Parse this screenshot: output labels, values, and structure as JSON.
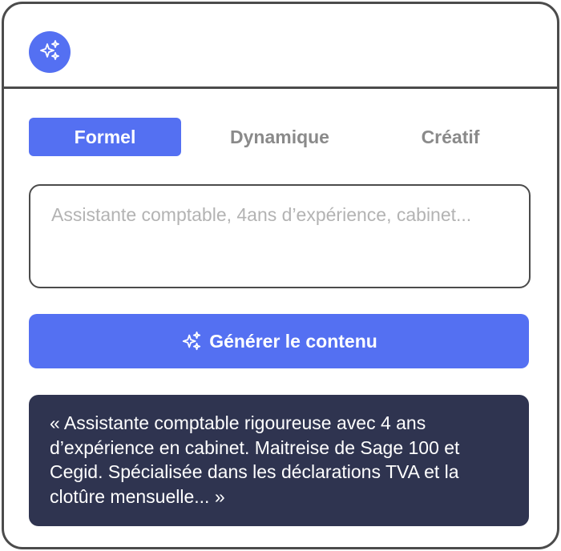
{
  "header": {
    "logo_icon": "sparkles-icon"
  },
  "tabs": [
    {
      "label": "Formel",
      "active": true
    },
    {
      "label": "Dynamique",
      "active": false
    },
    {
      "label": "Créatif",
      "active": false
    }
  ],
  "input": {
    "placeholder": "Assistante comptable, 4ans d’expérience, cabinet..."
  },
  "generate": {
    "label": "Générer le contenu",
    "icon": "sparkles-icon"
  },
  "result": {
    "text": "« Assistante comptable rigoureuse avec 4 ans d’expérience en cabinet. Maitreise de Sage 100 et Cegid. Spécialisée dans les déclarations TVA et la clotûre mensuelle... »"
  },
  "colors": {
    "accent": "#5470f2",
    "result_bg": "#2f3450",
    "border": "#4b4b4b",
    "inactive_tab": "#8a8a8a",
    "placeholder": "#b3b3b3"
  }
}
